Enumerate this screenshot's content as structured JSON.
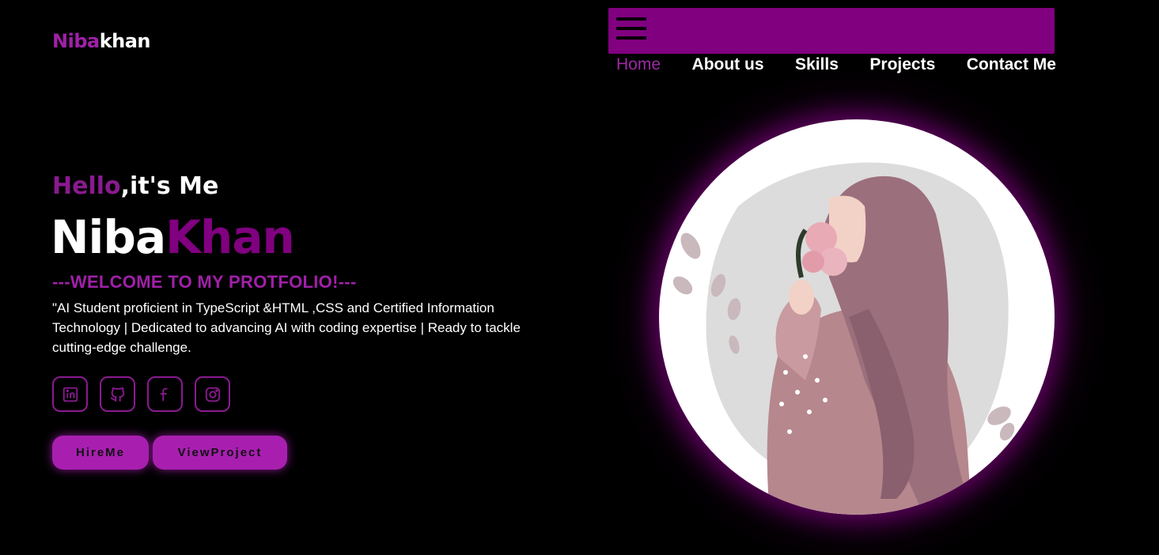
{
  "logo": {
    "accent": "Niba",
    "rest": "khan"
  },
  "menu": {
    "icon": "hamburger-icon"
  },
  "nav": {
    "items": [
      {
        "label": "Home"
      },
      {
        "label": "About us"
      },
      {
        "label": "Skills"
      },
      {
        "label": "Projects"
      },
      {
        "label": "Contact Me"
      }
    ]
  },
  "hero": {
    "hello_accent": "Hello",
    "hello_rest": ",it's Me",
    "name_first": "Niba",
    "name_last": "Khan",
    "welcome": "---WELCOME TO MY PROTFOLIO!---",
    "bio": "\"AI Student proficient in TypeScript &HTML ,CSS and Certified Information Technology | Dedicated to advancing AI with coding expertise | Ready to tackle cutting-edge challenge."
  },
  "socials": [
    {
      "icon": "linkedin-icon"
    },
    {
      "icon": "github-icon"
    },
    {
      "icon": "facebook-icon"
    },
    {
      "icon": "instagram-icon"
    }
  ],
  "buttons": {
    "hire": "HireMe",
    "view": "ViewProject"
  },
  "colors": {
    "accent": "#800080",
    "accent_bright": "#a81fb0",
    "background": "#000000"
  }
}
